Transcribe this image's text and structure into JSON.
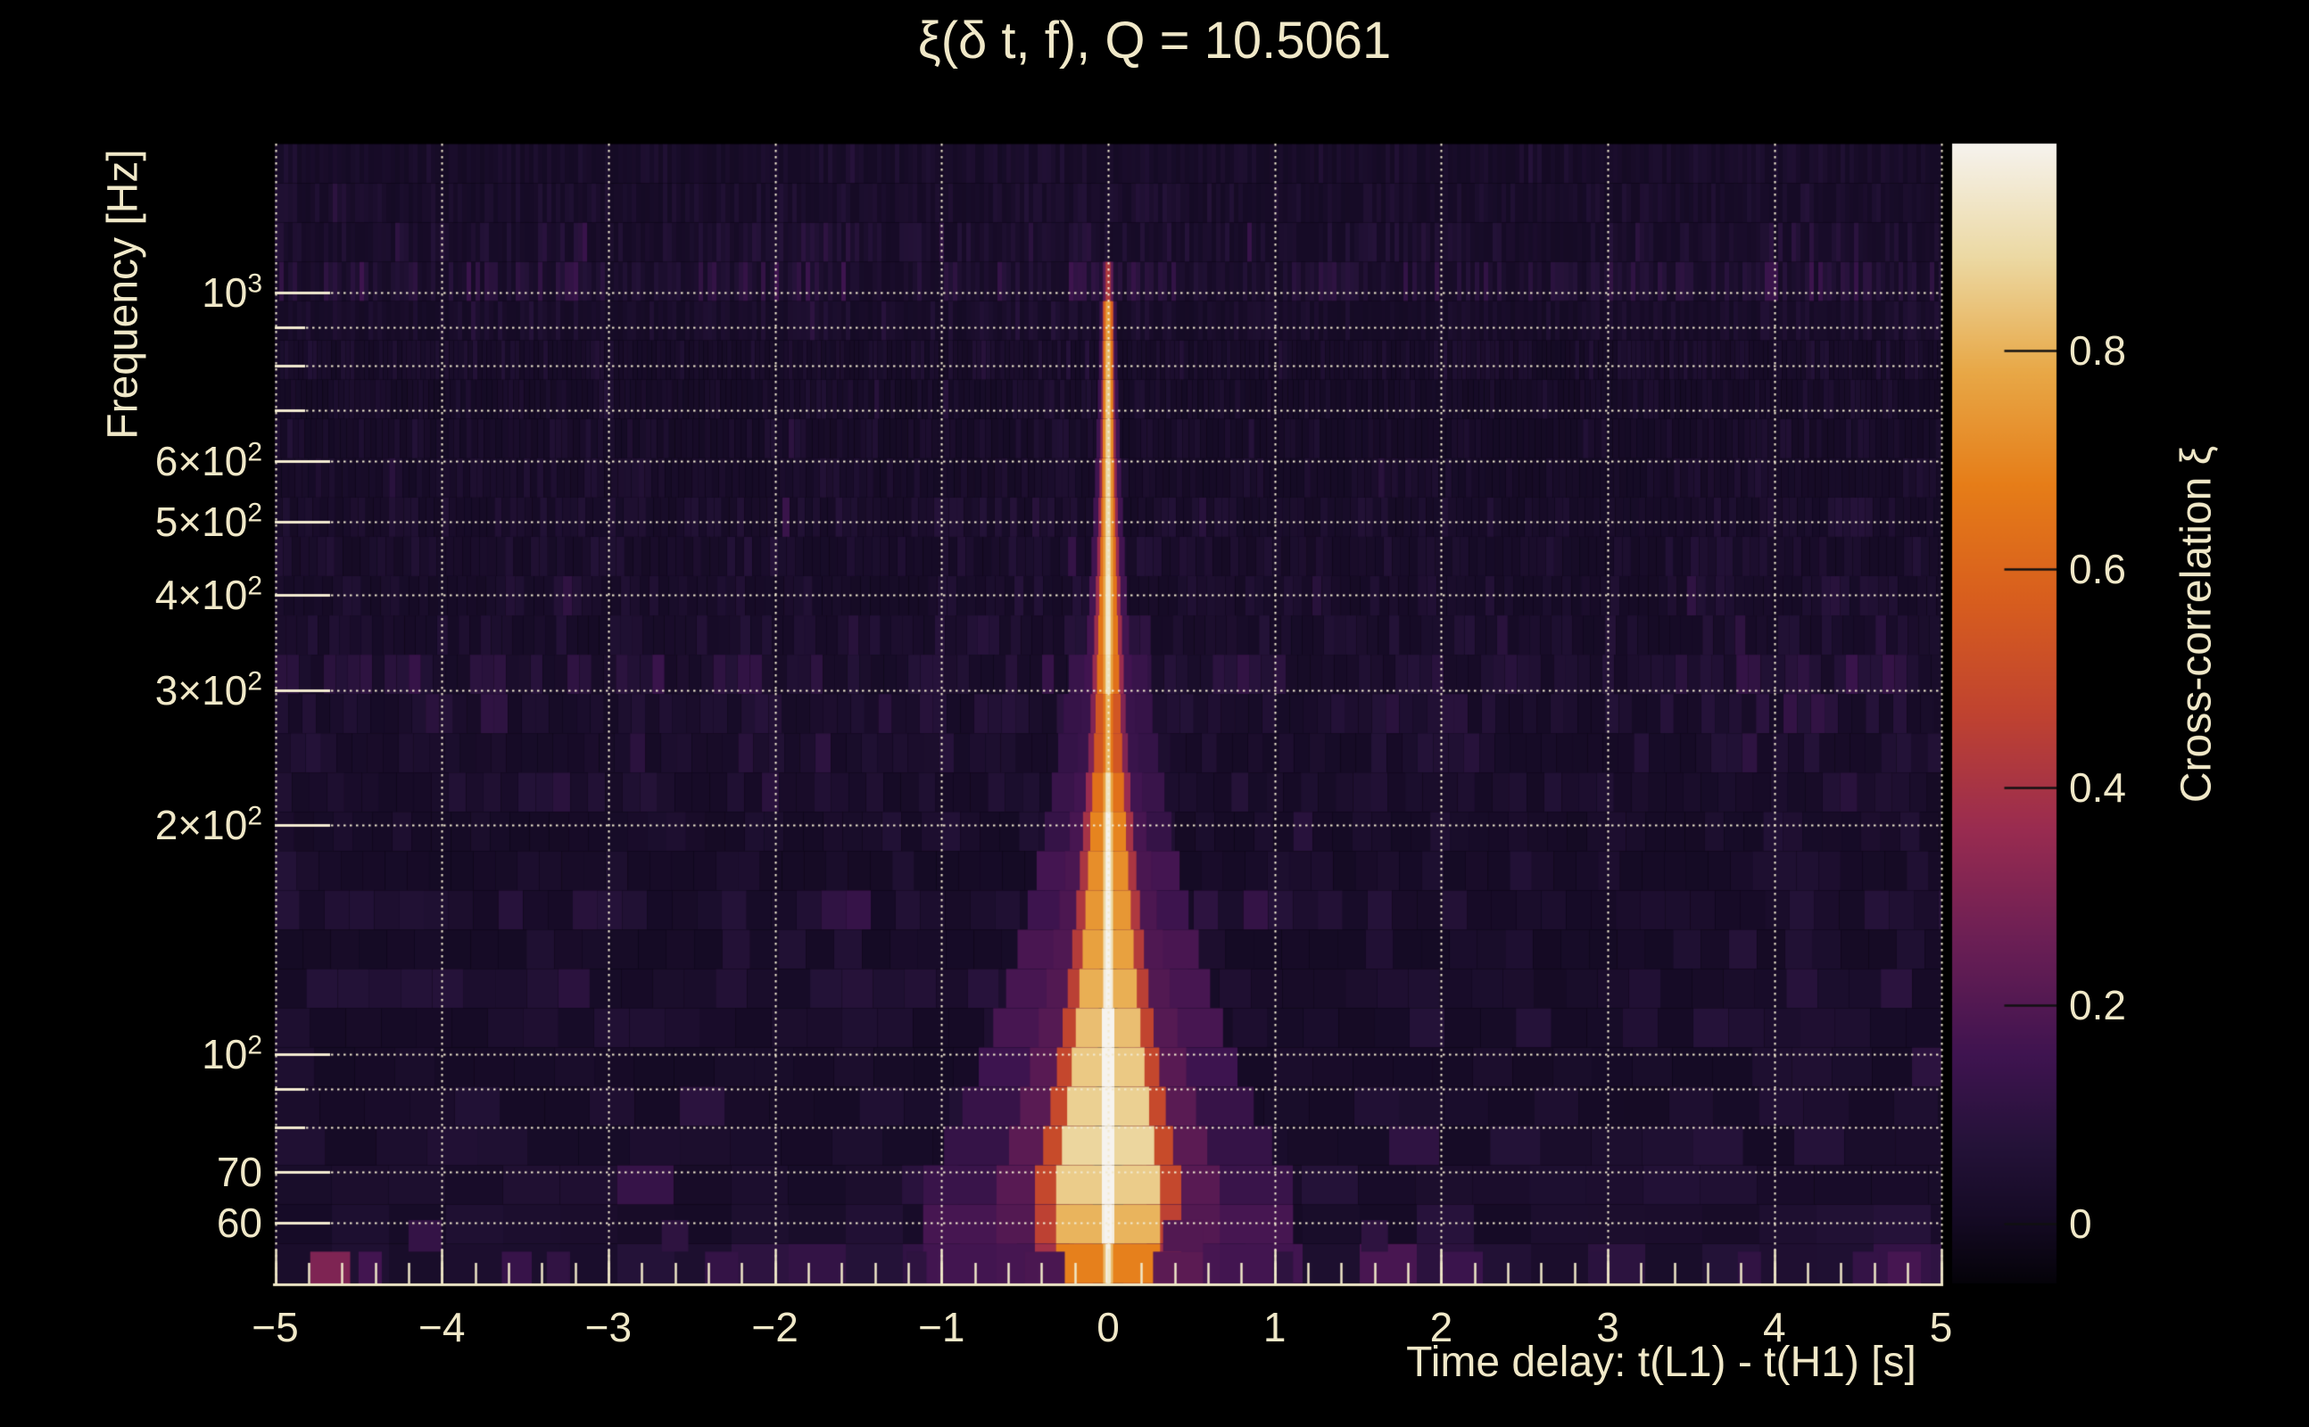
{
  "chart_data": {
    "type": "heatmap",
    "title": "ξ(δ t, f), Q = 10.5061",
    "q_value": 10.5061,
    "xlabel": "Time delay: t(L1) - t(H1) [s]",
    "ylabel": "Frequency [Hz]",
    "description": "Cross-correlation ξ between L1 and H1 as a function of time delay and frequency. Dark purple noise background with a narrow bright correlation ridge at δt ≈ 0 spanning ~50–1050 Hz, white-hot near 60–120 Hz, and a noisy anomaly band below ~55 Hz.",
    "x": {
      "range": [
        -5,
        5
      ],
      "minor_step": 0.2,
      "major_ticks": [
        {
          "v": -5,
          "label": "−5"
        },
        {
          "v": -4,
          "label": "−4"
        },
        {
          "v": -3,
          "label": "−3"
        },
        {
          "v": -2,
          "label": "−2"
        },
        {
          "v": -1,
          "label": "−1"
        },
        {
          "v": 0,
          "label": "0"
        },
        {
          "v": 1,
          "label": "1"
        },
        {
          "v": 2,
          "label": "2"
        },
        {
          "v": 3,
          "label": "3"
        },
        {
          "v": 4,
          "label": "4"
        },
        {
          "v": 5,
          "label": "5"
        }
      ]
    },
    "y": {
      "scale": "log",
      "range_hz": [
        50,
        1565
      ],
      "major_ticks": [
        {
          "hz": 1000,
          "base": "10",
          "sup": "3"
        },
        {
          "hz": 600,
          "base": "6×10",
          "sup": "2"
        },
        {
          "hz": 500,
          "base": "5×10",
          "sup": "2"
        },
        {
          "hz": 400,
          "base": "4×10",
          "sup": "2"
        },
        {
          "hz": 300,
          "base": "3×10",
          "sup": "2"
        },
        {
          "hz": 200,
          "base": "2×10",
          "sup": "2"
        },
        {
          "hz": 100,
          "base": "10",
          "sup": "2"
        },
        {
          "hz": 70,
          "base": "70",
          "sup": ""
        },
        {
          "hz": 60,
          "base": "60",
          "sup": ""
        }
      ],
      "minor_gridlines_hz": [
        900,
        800,
        700,
        90,
        80
      ]
    },
    "colorbar": {
      "label": "Cross-correlation ξ",
      "range": [
        -0.055,
        0.99
      ],
      "ticks": [
        {
          "v": 0.8,
          "label": "0.8"
        },
        {
          "v": 0.6,
          "label": "0.6"
        },
        {
          "v": 0.4,
          "label": "0.4"
        },
        {
          "v": 0.2,
          "label": "0.2"
        },
        {
          "v": 0.0,
          "label": "0"
        }
      ]
    },
    "colormap_stops": [
      [
        0.0,
        "#050309"
      ],
      [
        0.06,
        "#160b26"
      ],
      [
        0.12,
        "#241238"
      ],
      [
        0.2,
        "#3f1450"
      ],
      [
        0.3,
        "#6b1f55"
      ],
      [
        0.4,
        "#9a2c50"
      ],
      [
        0.5,
        "#c04330"
      ],
      [
        0.6,
        "#d85e1e"
      ],
      [
        0.7,
        "#e67d18"
      ],
      [
        0.8,
        "#e8a847"
      ],
      [
        0.9,
        "#ecd9a3"
      ],
      [
        1.0,
        "#f6f3ee"
      ]
    ],
    "ridge": {
      "center_dt": 0,
      "profile": [
        [
          1565,
          0.02
        ],
        [
          1150,
          0.03
        ],
        [
          1080,
          0.12
        ],
        [
          1020,
          0.25
        ],
        [
          970,
          0.42
        ],
        [
          920,
          0.55
        ],
        [
          860,
          0.6
        ],
        [
          780,
          0.63
        ],
        [
          690,
          0.66
        ],
        [
          610,
          0.68
        ],
        [
          540,
          0.7
        ],
        [
          480,
          0.7
        ],
        [
          430,
          0.73
        ],
        [
          380,
          0.75
        ],
        [
          330,
          0.74
        ],
        [
          300,
          0.7
        ],
        [
          272,
          0.58
        ],
        [
          245,
          0.62
        ],
        [
          215,
          0.75
        ],
        [
          190,
          0.8
        ],
        [
          168,
          0.82
        ],
        [
          148,
          0.85
        ],
        [
          130,
          0.88
        ],
        [
          114,
          0.93
        ],
        [
          100,
          0.96
        ],
        [
          88,
          0.98
        ],
        [
          76,
          1.0
        ],
        [
          66,
          0.97
        ],
        [
          58,
          0.9
        ],
        [
          52,
          0.75
        ],
        [
          50,
          0.6
        ]
      ]
    },
    "background_noise_xi": [
      0.0,
      0.08
    ],
    "bottom_band": {
      "f_range_hz": [
        50,
        55
      ],
      "patches": [
        {
          "dt": -4.67,
          "hw": 0.12,
          "xi": 0.3
        },
        {
          "dt": -4.43,
          "hw": 0.07,
          "xi": 0.16
        },
        {
          "dt": -3.55,
          "hw": 0.09,
          "xi": 0.13
        },
        {
          "dt": -3.3,
          "hw": 0.07,
          "xi": 0.11
        },
        {
          "dt": -2.32,
          "hw": 0.1,
          "xi": 0.12
        },
        {
          "dt": -1.15,
          "hw": 0.06,
          "xi": 0.1
        },
        {
          "dt": -0.38,
          "hw": 0.12,
          "xi": 0.18
        },
        {
          "dt": 0.42,
          "hw": 0.15,
          "xi": 0.22
        },
        {
          "dt": 1.05,
          "hw": 0.06,
          "xi": 0.1
        },
        {
          "dt": 2.12,
          "hw": 0.13,
          "xi": 0.14
        },
        {
          "dt": 2.95,
          "hw": 0.06,
          "xi": 0.09
        },
        {
          "dt": 3.85,
          "hw": 0.07,
          "xi": 0.11
        },
        {
          "dt": 4.55,
          "hw": 0.08,
          "xi": 0.12
        },
        {
          "dt": 4.78,
          "hw": 0.1,
          "xi": 0.17
        }
      ],
      "band2_patches": [
        {
          "dt": -4.1,
          "hw": 0.1,
          "xi": 0.12
        },
        {
          "dt": -2.6,
          "hw": 0.08,
          "xi": 0.1
        },
        {
          "dt": 0.45,
          "hw": 0.12,
          "xi": 0.2
        },
        {
          "dt": 1.6,
          "hw": 0.08,
          "xi": 0.1
        }
      ]
    },
    "colors": {
      "background": "#000000",
      "text": "#f0e8c8",
      "grid": "#f2ead0",
      "axis_line": "#f0e8c8",
      "colorbar_tick": "#111111"
    }
  }
}
